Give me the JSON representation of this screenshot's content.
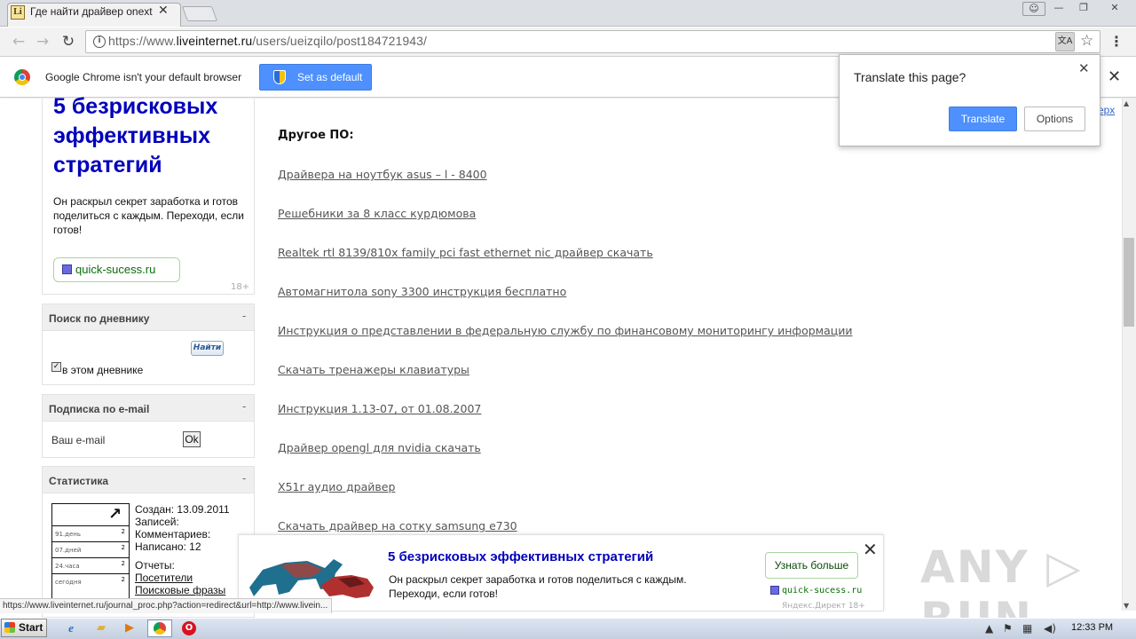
{
  "browser": {
    "tab_title": "Где найти драйвер onext",
    "tab_favicon_text": "Li",
    "url_prefix": "https://www.",
    "url_domain": "liveinternet.ru",
    "url_path": "/users/ueizqilo/post184721943/",
    "window_user_icon": "user-icon",
    "window_min": "—",
    "window_max": "❐",
    "window_close": "✕"
  },
  "infobar": {
    "message": "Google Chrome isn't your default browser",
    "set_default_label": "Set as default"
  },
  "translate_popup": {
    "title": "Translate this page?",
    "translate_label": "Translate",
    "options_label": "Options"
  },
  "sidebar": {
    "ad": {
      "title": "5 безрисковых эффективных стратегий",
      "text": "Он раскрыл секрет заработка и готов поделиться с каждым. Переходи, если готов!",
      "link": "quick-sucess.ru",
      "age": "18+"
    },
    "search": {
      "header": "Поиск по дневнику",
      "toggle": "-",
      "button": "Найти",
      "checkbox_label": "в этом дневнике",
      "checked": true
    },
    "subscribe": {
      "header": "Подписка по e-mail",
      "toggle": "-",
      "email_label": "Ваш e-mail",
      "ok_label": "Ok"
    },
    "stats": {
      "header": "Статистика",
      "toggle": "-",
      "rows": [
        {
          "label": "91.день",
          "value": "2"
        },
        {
          "label": "07.дней",
          "value": "2"
        },
        {
          "label": "24.часа",
          "value": "2"
        },
        {
          "label": "сегодня",
          "value": "2"
        }
      ],
      "created": "Создан: 13.09.2011",
      "entries": "Записей:",
      "comments": "Комментариев:",
      "written": "Написано: 12",
      "reports": "Отчеты:",
      "visitors": "Посетители",
      "search_phrases": "Поисковые фразы"
    }
  },
  "main": {
    "heading": "Другое ПО:",
    "yandex_partial": "ерх",
    "links": [
      "Драйвера на ноутбук asus – l - 8400",
      "Решебники за 8 класс курдюмова",
      "Realtek rtl 8139/810x family pci fast ethernet nic драйвер скачать",
      "Автомагнитола sony 3300 инструкция бесплатно",
      "Инструкция о представлении в федеральную службу по финансовому мониторингу информации",
      "Скачать тренажеры клавиатуры",
      "Инструкция 1.13-07, от 01.08.2007",
      "Драйвер opengl для nvidia скачать",
      "X51r аудио драйвер",
      "Скачать драйвер на сотку samsung e730"
    ]
  },
  "bottom_ad": {
    "title": "5 безрисковых эффективных стратегий",
    "text": "Он раскрыл секрет заработка и готов поделиться с каждым. Переходи, если готов!",
    "button": "Узнать больше",
    "site": "quick-sucess.ru",
    "footer": "Яндекс.Директ 18+"
  },
  "status_url": "https://www.liveinternet.ru/journal_proc.php?action=redirect&url=http://www.livein...",
  "watermark": "ANY ▷ RUN",
  "taskbar": {
    "start_label": "Start",
    "clock": "12:33 PM"
  },
  "colors": {
    "accent_blue": "#4d90fe",
    "ad_title": "#0000bb",
    "ad_green": "#0a6e0a"
  }
}
